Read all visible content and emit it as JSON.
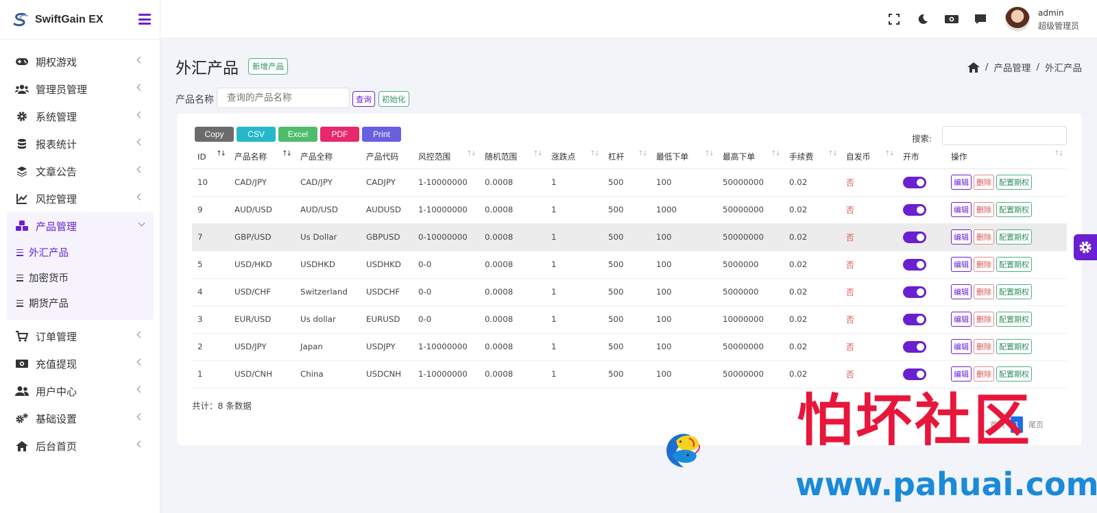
{
  "brand": {
    "name": "SwiftGain EX"
  },
  "sidebar": {
    "items": [
      {
        "label": "期权游戏",
        "icon": "gamepad-icon"
      },
      {
        "label": "管理员管理",
        "icon": "users-icon"
      },
      {
        "label": "系统管理",
        "icon": "gear-icon"
      },
      {
        "label": "报表统计",
        "icon": "database-icon"
      },
      {
        "label": "文章公告",
        "icon": "layers-icon"
      },
      {
        "label": "风控管理",
        "icon": "chart-line-icon"
      },
      {
        "label": "产品管理",
        "icon": "cubes-icon"
      },
      {
        "label": "订单管理",
        "icon": "cart-icon"
      },
      {
        "label": "充值提现",
        "icon": "money-icon"
      },
      {
        "label": "用户中心",
        "icon": "user-group-icon"
      },
      {
        "label": "基础设置",
        "icon": "gears-icon"
      },
      {
        "label": "后台首页",
        "icon": "home-icon"
      }
    ],
    "submenu": [
      {
        "label": "外汇产品"
      },
      {
        "label": "加密货币"
      },
      {
        "label": "期货产品"
      }
    ]
  },
  "topbar": {
    "user_name": "admin",
    "user_role": "超级管理员"
  },
  "page": {
    "title": "外汇产品",
    "new_button": "新增产品",
    "breadcrumb": [
      "产品管理",
      "外汇产品"
    ],
    "filter_label": "产品名称",
    "filter_placeholder": "查询的产品名称",
    "query_button": "查询",
    "reset_button": "初始化"
  },
  "table_tools": {
    "export": [
      {
        "label": "Copy",
        "color": "#6c6c6c"
      },
      {
        "label": "CSV",
        "color": "#27b7cb"
      },
      {
        "label": "Excel",
        "color": "#4ebc6b"
      },
      {
        "label": "PDF",
        "color": "#e8286c"
      },
      {
        "label": "Print",
        "color": "#6a5fe0"
      }
    ],
    "search_label": "搜索:"
  },
  "table": {
    "columns": [
      "ID",
      "产品名称",
      "产品全称",
      "产品代码",
      "风控范围",
      "随机范围",
      "涨跌点",
      "杠杆",
      "最低下单",
      "最高下单",
      "手续费",
      "自发币",
      "开市",
      "操作"
    ],
    "rows": [
      {
        "id": "10",
        "name": "CAD/JPY",
        "full": "CAD/JPY",
        "code": "CADJPY",
        "risk": "1-10000000",
        "rand": "0.0008",
        "pt": "1",
        "lev": "500",
        "min": "100",
        "max": "50000000",
        "fee": "0.02",
        "self": "否"
      },
      {
        "id": "9",
        "name": "AUD/USD",
        "full": "AUD/USD",
        "code": "AUDUSD",
        "risk": "1-10000000",
        "rand": "0.0008",
        "pt": "1",
        "lev": "500",
        "min": "1000",
        "max": "50000000",
        "fee": "0.02",
        "self": "否"
      },
      {
        "id": "7",
        "name": "GBP/USD",
        "full": "Us Dollar",
        "code": "GBPUSD",
        "risk": "0-10000000",
        "rand": "0.0008",
        "pt": "1",
        "lev": "500",
        "min": "100",
        "max": "50000000",
        "fee": "0.02",
        "self": "否"
      },
      {
        "id": "5",
        "name": "USD/HKD",
        "full": "USDHKD",
        "code": "USDHKD",
        "risk": "0-0",
        "rand": "0.0008",
        "pt": "1",
        "lev": "500",
        "min": "100",
        "max": "5000000",
        "fee": "0.02",
        "self": "否"
      },
      {
        "id": "4",
        "name": "USD/CHF",
        "full": "Switzerland",
        "code": "USDCHF",
        "risk": "0-0",
        "rand": "0.0008",
        "pt": "1",
        "lev": "500",
        "min": "100",
        "max": "5000000",
        "fee": "0.02",
        "self": "否"
      },
      {
        "id": "3",
        "name": "EUR/USD",
        "full": "Us dollar",
        "code": "EURUSD",
        "risk": "0-0",
        "rand": "0.0008",
        "pt": "1",
        "lev": "500",
        "min": "100",
        "max": "10000000",
        "fee": "0.02",
        "self": "否"
      },
      {
        "id": "2",
        "name": "USD/JPY",
        "full": "Japan",
        "code": "USDJPY",
        "risk": "1-10000000",
        "rand": "0.0008",
        "pt": "1",
        "lev": "500",
        "min": "100",
        "max": "50000000",
        "fee": "0.02",
        "self": "否"
      },
      {
        "id": "1",
        "name": "USD/CNH",
        "full": "China",
        "code": "USDCNH",
        "risk": "1-10000000",
        "rand": "0.0008",
        "pt": "1",
        "lev": "500",
        "min": "100",
        "max": "50000000",
        "fee": "0.02",
        "self": "否"
      }
    ],
    "ops": {
      "edit": "编辑",
      "delete": "删除",
      "config": "配置期权"
    }
  },
  "footer": {
    "total": "共计：8 条数据",
    "pager_first": "首页",
    "pager_current": "1",
    "pager_last": "尾页"
  },
  "watermark": {
    "cn": "怕坏社区",
    "url": "www.pahuai.com"
  },
  "colors": {
    "accent": "#6a1fd1",
    "danger": "#d9534f",
    "success": "#2f8d5f"
  }
}
